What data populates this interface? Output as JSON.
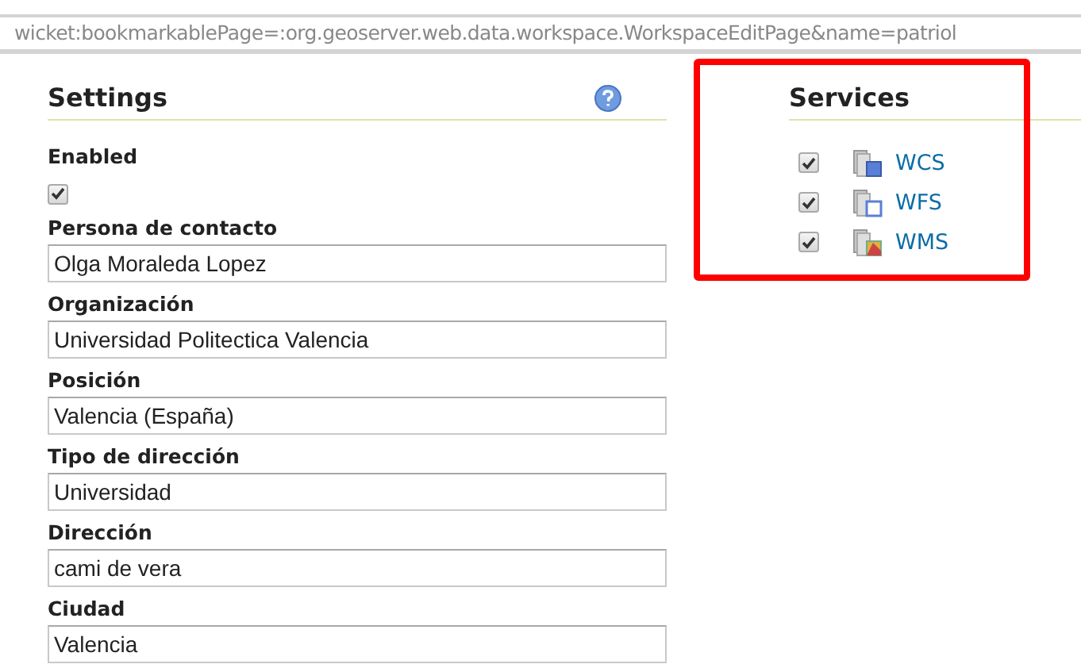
{
  "address_bar": {
    "url": "wicket:bookmarkablePage=:org.geoserver.web.data.workspace.WorkspaceEditPage&name=patriol"
  },
  "settings": {
    "title": "Settings",
    "enabled": {
      "label": "Enabled",
      "checked": true
    },
    "fields": [
      {
        "label": "Persona de contacto",
        "value": "Olga Moraleda Lopez"
      },
      {
        "label": "Organización",
        "value": "Universidad Politectica Valencia"
      },
      {
        "label": "Posición",
        "value": "Valencia (España)"
      },
      {
        "label": "Tipo de dirección",
        "value": "Universidad"
      },
      {
        "label": "Dirección",
        "value": "cami de vera"
      },
      {
        "label": "Ciudad",
        "value": "Valencia"
      }
    ]
  },
  "services": {
    "title": "Services",
    "highlighted": true,
    "items": [
      {
        "name": "WCS",
        "kind": "wcs",
        "checked": true
      },
      {
        "name": "WFS",
        "kind": "wfs",
        "checked": true
      },
      {
        "name": "WMS",
        "kind": "wms",
        "checked": true
      }
    ]
  }
}
